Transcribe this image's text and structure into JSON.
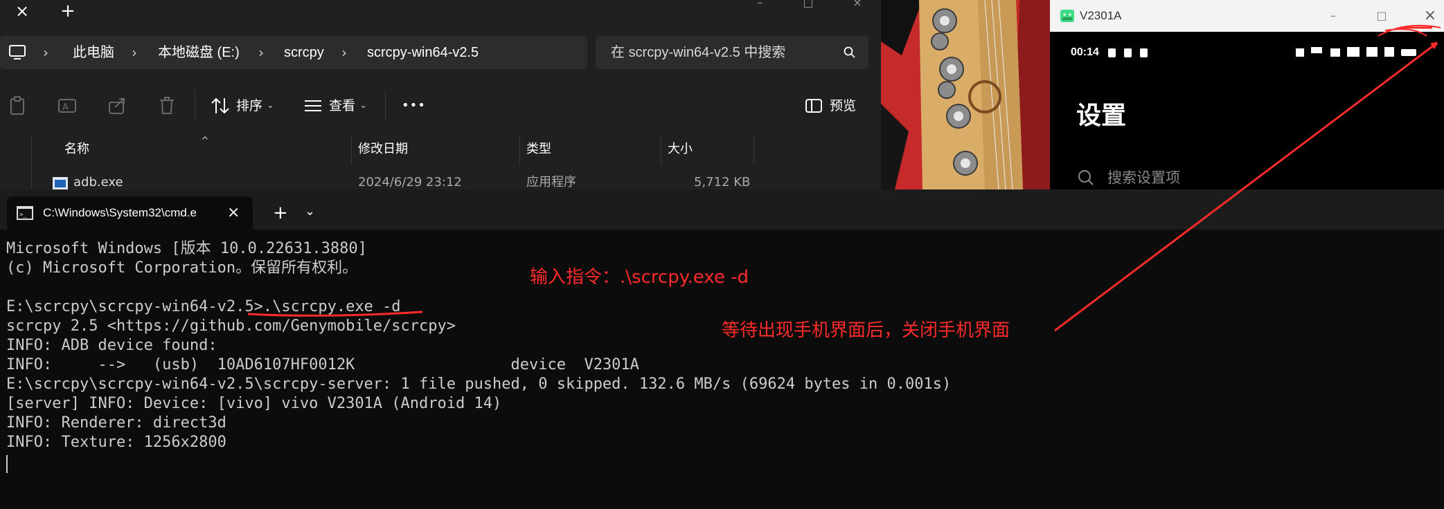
{
  "explorer": {
    "breadcrumb": [
      "此电脑",
      "本地磁盘 (E:)",
      "scrcpy",
      "scrcpy-win64-v2.5"
    ],
    "search_placeholder": "在 scrcpy-win64-v2.5 中搜索",
    "toolbar": {
      "sort_label": "排序",
      "view_label": "查看",
      "more_label": "•••",
      "preview_label": "预览"
    },
    "columns": [
      "名称",
      "修改日期",
      "类型",
      "大小"
    ],
    "rows": [
      {
        "name": "adb.exe",
        "date": "2024/6/29 23:12",
        "type": "应用程序",
        "size": "5,712 KB"
      }
    ]
  },
  "phone_window": {
    "title": "V2301A",
    "status_time": "00:14",
    "heading": "设置",
    "search_placeholder": "搜索设置项"
  },
  "terminal": {
    "tab_title": "C:\\Windows\\System32\\cmd.e",
    "lines": [
      "Microsoft Windows [版本 10.0.22631.3880]",
      "(c) Microsoft Corporation。保留所有权利。",
      "",
      "E:\\scrcpy\\scrcpy-win64-v2.5>.\\scrcpy.exe -d",
      "scrcpy 2.5 <https://github.com/Genymobile/scrcpy>",
      "INFO: ADB device found:",
      "INFO:     -->   (usb)  10AD6107HF0012K                 device  V2301A",
      "E:\\scrcpy\\scrcpy-win64-v2.5\\scrcpy-server: 1 file pushed, 0 skipped. 132.6 MB/s (69624 bytes in 0.001s)",
      "[server] INFO: Device: [vivo] vivo V2301A (Android 14)",
      "INFO: Renderer: direct3d",
      "INFO: Texture: 1256x2800"
    ]
  },
  "annotations": {
    "instruction": "输入指令：.\\scrcpy.exe -d",
    "wait_note": "等待出现手机界面后，关闭手机界面",
    "color": "#ff2a2a"
  }
}
